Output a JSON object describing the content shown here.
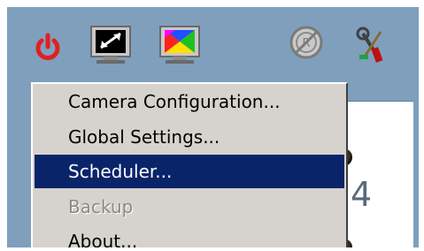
{
  "toolbar": {
    "icons": [
      "power-icon",
      "monitor-monochrome-icon",
      "monitor-color-icon",
      "no-recording-icon",
      "tools-icon"
    ]
  },
  "panel": {
    "digit": "4"
  },
  "menu": {
    "items": [
      {
        "label": "Camera Configuration...",
        "state": "normal"
      },
      {
        "label": "Global Settings...",
        "state": "normal"
      },
      {
        "label": "Scheduler...",
        "state": "highlighted"
      },
      {
        "label": "Backup",
        "state": "disabled"
      },
      {
        "label": "About...",
        "state": "normal"
      }
    ]
  },
  "colors": {
    "background": "#7f9fbd",
    "menu_bg": "#d6d3ce",
    "highlight": "#0a246a",
    "power": "#e02020"
  }
}
